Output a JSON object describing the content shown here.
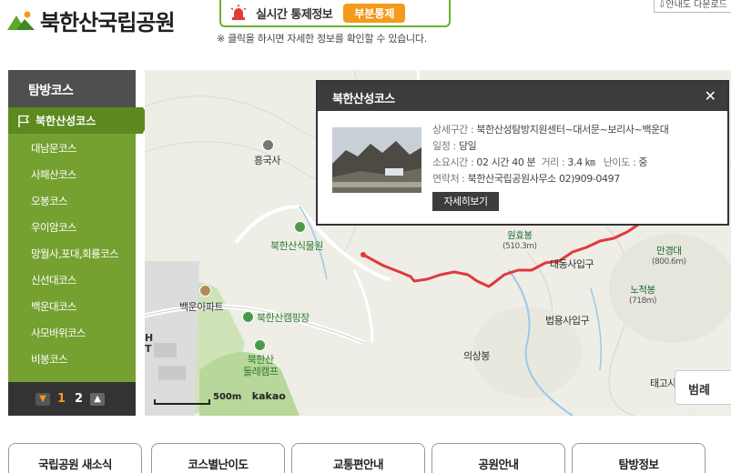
{
  "header": {
    "logo_text": "북한산국립공원",
    "status_label": "실시간 통제정보",
    "status_badge": "부분통제",
    "status_note": "※ 클릭을 하시면 자세한 정보를 확인할 수 있습니다.",
    "download_label": "안내도 다운로드"
  },
  "sidebar": {
    "title": "탐방코스",
    "active_item": "북한산성코스",
    "items": [
      "대남문코스",
      "사패산코스",
      "오봉코스",
      "우이암코스",
      "망월사,포대,회룡코스",
      "신선대코스",
      "백운대코스",
      "사모바위코스",
      "비봉코스"
    ],
    "pager": {
      "current": "1",
      "next": "2"
    }
  },
  "map": {
    "labels": {
      "temple": "흥국사",
      "arboretum": "북한산식물원",
      "apartment": "백운아파트",
      "camping": "북한산캠핑장",
      "camp2_line1": "북한산",
      "camp2_line2": "둘레캠프",
      "daedong": "대동사입구",
      "beopyong": "법용사입구",
      "uisang": "의상봉",
      "taego": "태고사",
      "h_text": "H",
      "t_text": "T"
    },
    "peaks": [
      {
        "name": "원효봉",
        "elev": "(510.3m)"
      },
      {
        "name": "만경대",
        "elev": "(800.6m)"
      },
      {
        "name": "노적봉",
        "elev": "(718m)"
      }
    ],
    "scale_label": "500m",
    "brand": "kakao",
    "legend_label": "범례"
  },
  "popup": {
    "title": "북한산성코스",
    "rows": [
      {
        "key": "상세구간",
        "value": "북한산성탐방지원센터~대서문~보리사~백운대"
      },
      {
        "key": "일정",
        "value": "당일"
      }
    ],
    "time_key": "소요시간",
    "time_value": "02 시간 40 분",
    "dist_key": "거리",
    "dist_value": "3.4 ㎞",
    "level_key": "난이도",
    "level_value": "중",
    "contact_key": "연락처",
    "contact_value": "북한산국립공원사무소 02)909-0497",
    "detail_button": "자세히보기"
  },
  "tabs": [
    "국립공원 새소식",
    "코스별난이도",
    "교통편안내",
    "공원안내",
    "탐방정보"
  ],
  "colors": {
    "brand_green": "#75a131",
    "accent_orange": "#f49a1c",
    "route_red": "#e0393e"
  }
}
